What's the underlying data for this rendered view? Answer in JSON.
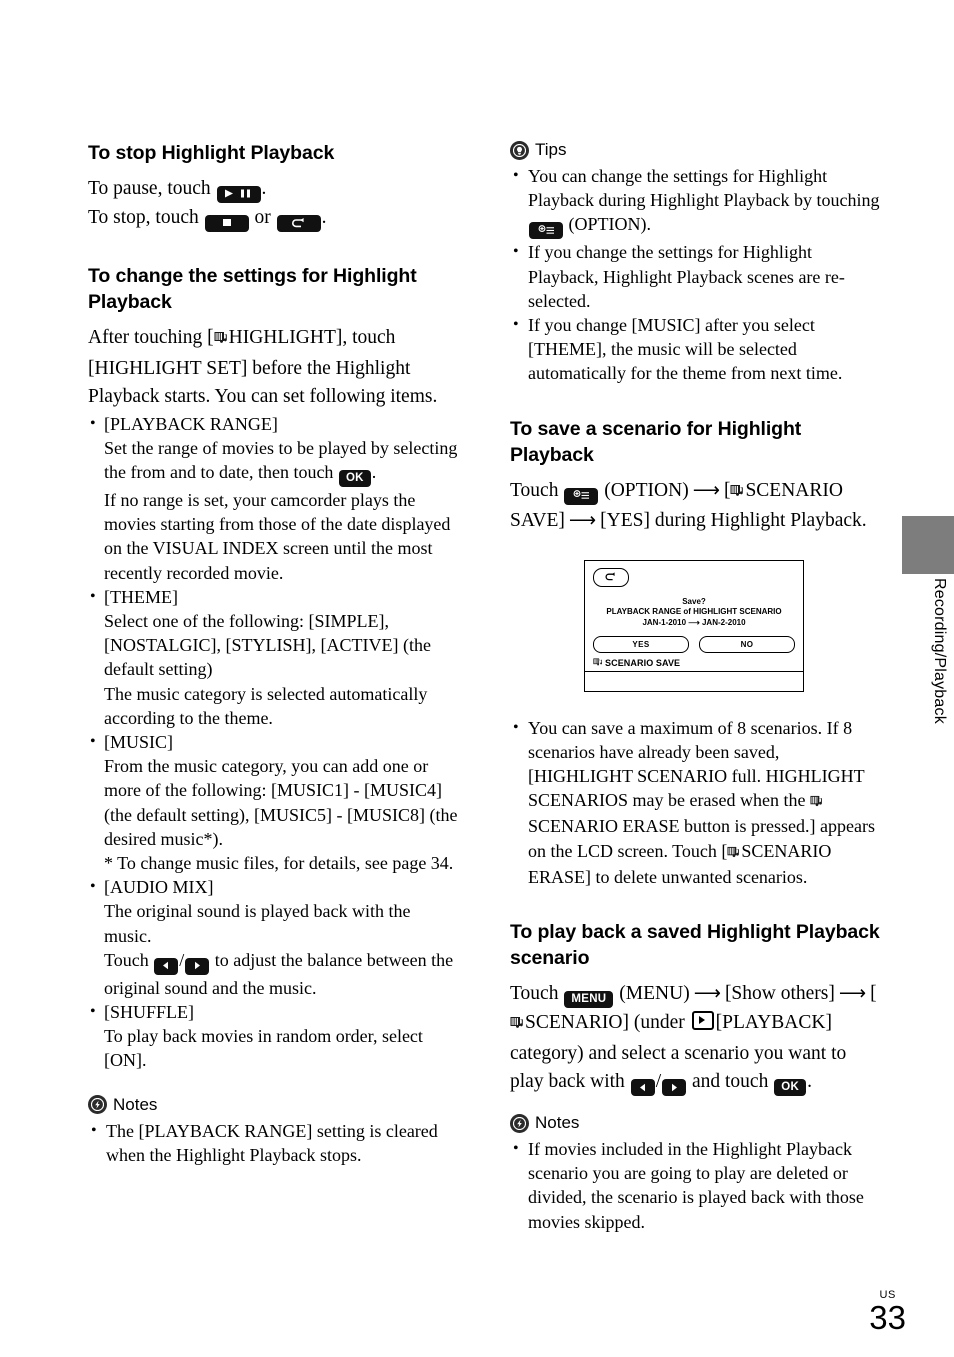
{
  "page": {
    "locale_label": "US",
    "number": "33",
    "side_tab_label": "Recording/Playback"
  },
  "left_column": {
    "section1": {
      "heading": "To stop Highlight Playback",
      "line1_pre": "To pause, touch",
      "line1_post": ".",
      "line2_pre": "To stop, touch",
      "line2_mid": "or",
      "line2_post": "."
    },
    "section2": {
      "heading": "To change the settings for Highlight Playback",
      "intro_pre": "After touching [",
      "intro_mid": "HIGHLIGHT], touch [HIGHLIGHT SET] before the Highlight Playback starts. You can set following items.",
      "items": [
        {
          "title": "[PLAYBACK RANGE]",
          "line_a_pre": "Set the range of movies to be played by selecting the from and to date, then touch",
          "line_a_post": ".",
          "line_b": "If no range is set, your camcorder plays the movies starting from those of the date displayed on the VISUAL INDEX screen until the most recently recorded movie."
        },
        {
          "title": "[THEME]",
          "line_a": "Select one of the following: [SIMPLE], [NOSTALGIC], [STYLISH], [ACTIVE] (the default setting)",
          "line_b": "The music category is selected automatically according to the theme."
        },
        {
          "title": "[MUSIC]",
          "line_a": "From the music category, you can add one or more of the following: [MUSIC1] - [MUSIC4] (the default setting), [MUSIC5] - [MUSIC8] (the desired music*).",
          "line_b": "* To change music files, for details, see page 34."
        },
        {
          "title": "[AUDIO MIX]",
          "line_a": "The original sound is played back with the music.",
          "line_b_pre": "Touch",
          "line_b_mid": "/",
          "line_b_post": "to adjust the balance between the original sound and the music."
        },
        {
          "title": "[SHUFFLE]",
          "line_a": "To play back movies in random order, select [ON]."
        }
      ]
    },
    "notes": {
      "heading": "Notes",
      "items": [
        "The [PLAYBACK RANGE] setting is cleared when the Highlight Playback stops."
      ]
    }
  },
  "right_column": {
    "tips": {
      "heading": "Tips",
      "item1_pre": "You can change the settings for Highlight Playback during Highlight Playback by touching",
      "item1_post": "(OPTION).",
      "item2": "If you change the settings for Highlight Playback, Highlight Playback scenes are re-selected.",
      "item3": "If you change [MUSIC] after you select [THEME], the music will be selected automatically for the theme from next time."
    },
    "section_save": {
      "heading": "To save a scenario for Highlight Playback",
      "line_pre": "Touch",
      "line_option": "(OPTION)",
      "line_mid": "[",
      "line_scenario": "SCENARIO SAVE]",
      "line_end": "[YES] during Highlight Playback."
    },
    "lcd": {
      "back_icon": "return-arrow-icon",
      "msg_line1": "Save?",
      "msg_line2": "PLAYBACK RANGE of HIGHLIGHT SCENARIO",
      "msg_line3_from": "JAN-1-2010",
      "msg_line3_to": "JAN-2-2010",
      "button_yes": "YES",
      "button_no": "NO",
      "footer_label": "SCENARIO SAVE"
    },
    "save_notes": [
      "You can save a maximum of 8 scenarios. If 8 scenarios have already been saved, [HIGHLIGHT SCENARIO full. HIGHLIGHT SCENARIOS may be erased when the"
    ],
    "save_note_cont1": "SCENARIO ERASE button is pressed.] appears on the LCD screen. Touch",
    "save_note_cont2": "[",
    "save_note_cont3": "SCENARIO ERASE] to delete unwanted scenarios.",
    "section_play": {
      "heading": "To play back a saved Highlight Playback scenario",
      "line_pre": "Touch",
      "line_menu": "(MENU)",
      "line_showothers": "[Show others]",
      "line_open": "[",
      "line_scenario": "SCENARIO] (under",
      "line_playback": "[PLAYBACK] category) and select a scenario you want to play back with",
      "line_slash": "/",
      "line_andtouch": "and touch",
      "line_end": "."
    },
    "notes": {
      "heading": "Notes",
      "items": [
        "If movies included in the Highlight Playback scenario you are going to play are deleted or divided, the scenario is played back with those movies skipped."
      ]
    }
  },
  "icons": {
    "play_pause": "play-pause-key-icon",
    "stop": "stop-key-icon",
    "back": "back-key-icon",
    "ok": "OK",
    "option": "option-key-icon",
    "menu": "MENU",
    "prev": "prev-arrow-key-icon",
    "next": "next-arrow-key-icon",
    "highlight": "highlight-music-icon",
    "playback_category": "playback-category-icon"
  },
  "colors": {
    "key_background": "#111111",
    "tab_gray": "#7d7d7d",
    "text": "#000000"
  }
}
